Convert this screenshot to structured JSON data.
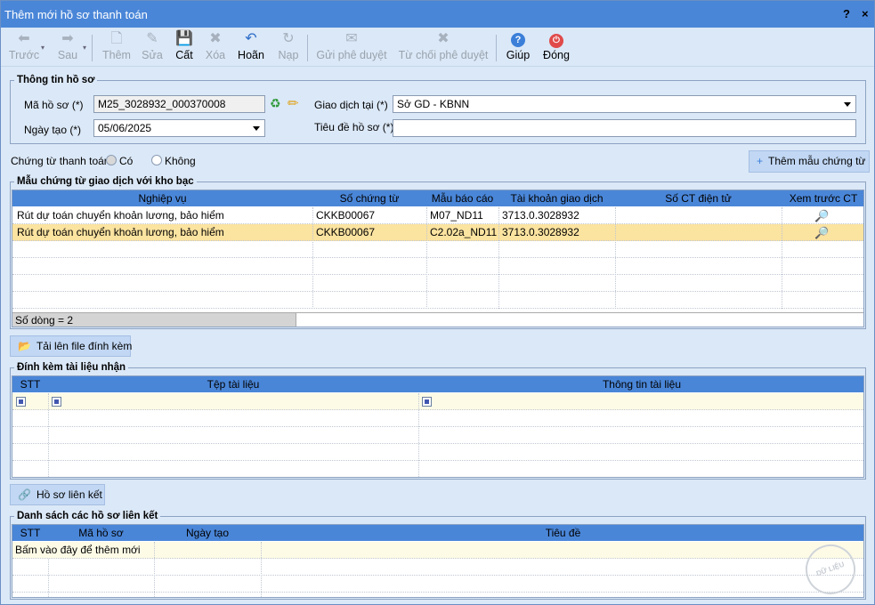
{
  "window": {
    "title": "Thêm mới hồ sơ thanh toán",
    "help_btn": "?",
    "close_btn": "×"
  },
  "toolbar": {
    "prev": "Trước",
    "next": "Sau",
    "add": "Thêm",
    "edit": "Sửa",
    "save": "Cất",
    "delete": "Xóa",
    "undo": "Hoãn",
    "reload": "Nạp",
    "send_approve": "Gửi phê duyệt",
    "reject_approve": "Từ chối phê duyệt",
    "help": "Giúp",
    "close": "Đóng"
  },
  "info": {
    "section_title": "Thông tin hồ sơ",
    "code_label": "Mã hồ sơ (*)",
    "code_value": "M25_3028932_000370008",
    "date_label": "Ngày tạo (*)",
    "date_value": "05/06/2025",
    "place_label": "Giao dịch tại (*)",
    "place_value": "Sở GD - KBNN",
    "title_label": "Tiêu đề hồ sơ (*)",
    "title_value": ""
  },
  "payment": {
    "label": "Chứng từ thanh toán:",
    "yes": "Có",
    "no": "Không",
    "add_template_btn": "Thêm mẫu chứng từ"
  },
  "templates": {
    "section_title": "Mẫu chứng từ giao dịch với kho bạc",
    "headers": [
      "Nghiệp vụ",
      "Số chứng từ",
      "Mẫu báo cáo",
      "Tài khoản giao dịch",
      "Số CT điện tử",
      "Xem trước CT"
    ],
    "rows": [
      {
        "business": "Rút dự toán chuyển khoản lương, bảo hiểm",
        "doc_no": "CKKB00067",
        "form": "M07_ND11",
        "account": "3713.0.3028932",
        "edoc": ""
      },
      {
        "business": "Rút dự toán chuyển khoản lương, bảo hiểm",
        "doc_no": "CKKB00067",
        "form": "C2.02a_ND11",
        "account": "3713.0.3028932",
        "edoc": ""
      }
    ],
    "row_count": "Số dòng = 2"
  },
  "upload": {
    "btn": "Tải lên file đính kèm"
  },
  "attachments": {
    "section_title": "Đính kèm tài liệu nhận",
    "headers": [
      "STT",
      "Tệp tài liệu",
      "Thông tin tài liệu"
    ]
  },
  "linked": {
    "btn": "Hồ sơ liên kết",
    "section_title": "Danh sách các hồ sơ liên kết",
    "headers": [
      "STT",
      "Mã hồ sơ",
      "Ngày tạo",
      "Tiêu đề"
    ],
    "add_hint": "Bấm vào đây để thêm mới"
  },
  "watermark": "DỮ LIỆU MẪU",
  "colors": {
    "header_blue": "#4a86d8",
    "selected_row": "#fbe3a0",
    "new_row": "#fdfbe6",
    "background": "#dbe8f7"
  }
}
